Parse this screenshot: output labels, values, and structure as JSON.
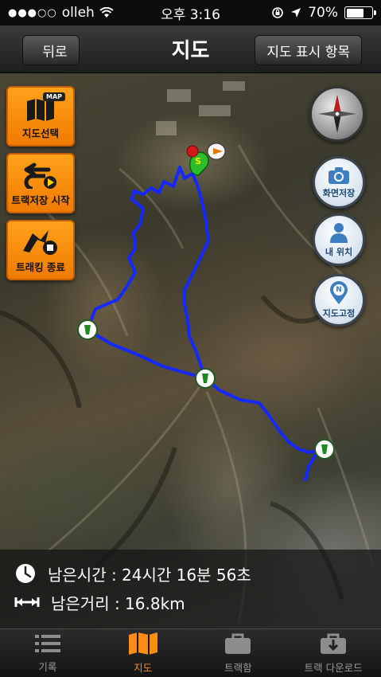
{
  "status_bar": {
    "carrier": "olleh",
    "time": "오후 3:16",
    "battery": "70%",
    "battery_level": 0.7
  },
  "nav": {
    "back_label": "뒤로",
    "title": "지도",
    "right_button_label": "지도 표시 항목"
  },
  "tools": {
    "map_select": "지도선택",
    "map_badge": "MAP",
    "track_save_start": "트랙저장 시작",
    "tracking_end": "트래킹 종료"
  },
  "map_controls": {
    "screen_save": "화면저장",
    "my_location": "내 위치",
    "map_lock": "지도고정"
  },
  "map_markers": {
    "start_badge": "S",
    "waypoint_badge": "N"
  },
  "info": {
    "remaining_time": "남은시간 : 24시간 16분 56초",
    "remaining_distance": "남은거리 : 16.8km"
  },
  "tabs": [
    {
      "label": "기록"
    },
    {
      "label": "지도"
    },
    {
      "label": "트랙함"
    },
    {
      "label": "트랙 다운로드"
    }
  ],
  "colors": {
    "track": "#1428ff",
    "accent": "#ff8c14",
    "label_red": "#c0151b"
  }
}
